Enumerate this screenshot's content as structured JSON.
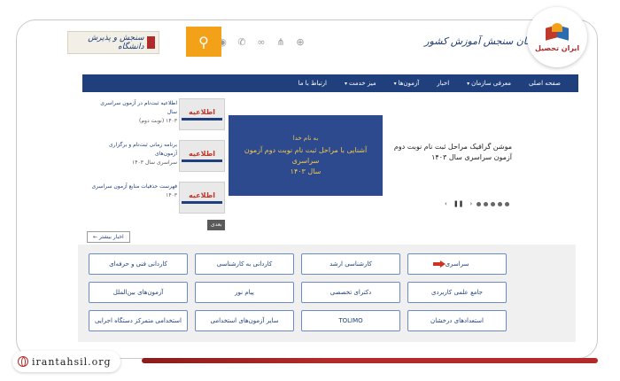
{
  "header": {
    "org_name": "سازمان سنجش آموزش کشور",
    "left_logo_text": "سنجش و پذیرش دانشگاه"
  },
  "icons": {
    "search": "search-icon",
    "social": [
      "rss-icon",
      "phone-icon",
      "link-icon",
      "share-icon",
      "globe-icon"
    ]
  },
  "nav": {
    "items": [
      "صفحه اصلی",
      "معرفی سازمان",
      "اخبار",
      "آزمون‌ها",
      "میز خدمت",
      "ارتباط با ما"
    ]
  },
  "news": [
    {
      "title": "اطلاعیه ثبت‌نام در آزمون سراسری سال",
      "date": "۱۴۰۳ (نوبت دوم)",
      "thumb_text": "اطلاعیه"
    },
    {
      "title": "برنامه زمانی ثبت‌نام و برگزاری آزمون‌های",
      "date": "سراسری سال ۱۴۰۳",
      "thumb_text": "اطلاعیه"
    },
    {
      "title": "فهرست حذفیات منابع آزمون سراسری",
      "date": "۱۴۰۳",
      "thumb_text": "اطلاعیه"
    }
  ],
  "slider": {
    "line1": "به نام خدا",
    "line2": "آشنایی با مراحل ثبت نام نوبت دوم آزمون سراسری",
    "line3": "سال ۱۴۰۳",
    "caption": "موشن گرافیک مراحل ثبت نام نوبت دوم آزمون سراسری سال ۱۴۰۳",
    "next_label": "بعدی",
    "prev": "‹",
    "pause": "❚❚",
    "next": "›"
  },
  "archive_label": "اخبار بیشتر ←",
  "exams": [
    {
      "label": "سراسری",
      "highlight": true
    },
    {
      "label": "کارشناسی ارشد"
    },
    {
      "label": "کاردانی به کارشناسی"
    },
    {
      "label": "کاردانی فنی و حرفه‌ای"
    },
    {
      "label": "جامع علمی کاربردی"
    },
    {
      "label": "دکترای تخصصی"
    },
    {
      "label": "پیام نور"
    },
    {
      "label": "آزمون‌های بین‌الملل"
    },
    {
      "label": "استعدادهای درخشان"
    },
    {
      "label": "TOLIMO"
    },
    {
      "label": "سایر آزمون‌های استخدامی"
    },
    {
      "label": "استخدامی متمرکز دستگاه اجرایی"
    }
  ],
  "brand": {
    "name": "ایران تحصیل",
    "url": "irantahsil.org"
  },
  "colors": {
    "nav": "#1f3f7d",
    "search": "#f4a11a",
    "brand_red": "#b22a2a",
    "slide_bg": "#2e4a8f"
  }
}
